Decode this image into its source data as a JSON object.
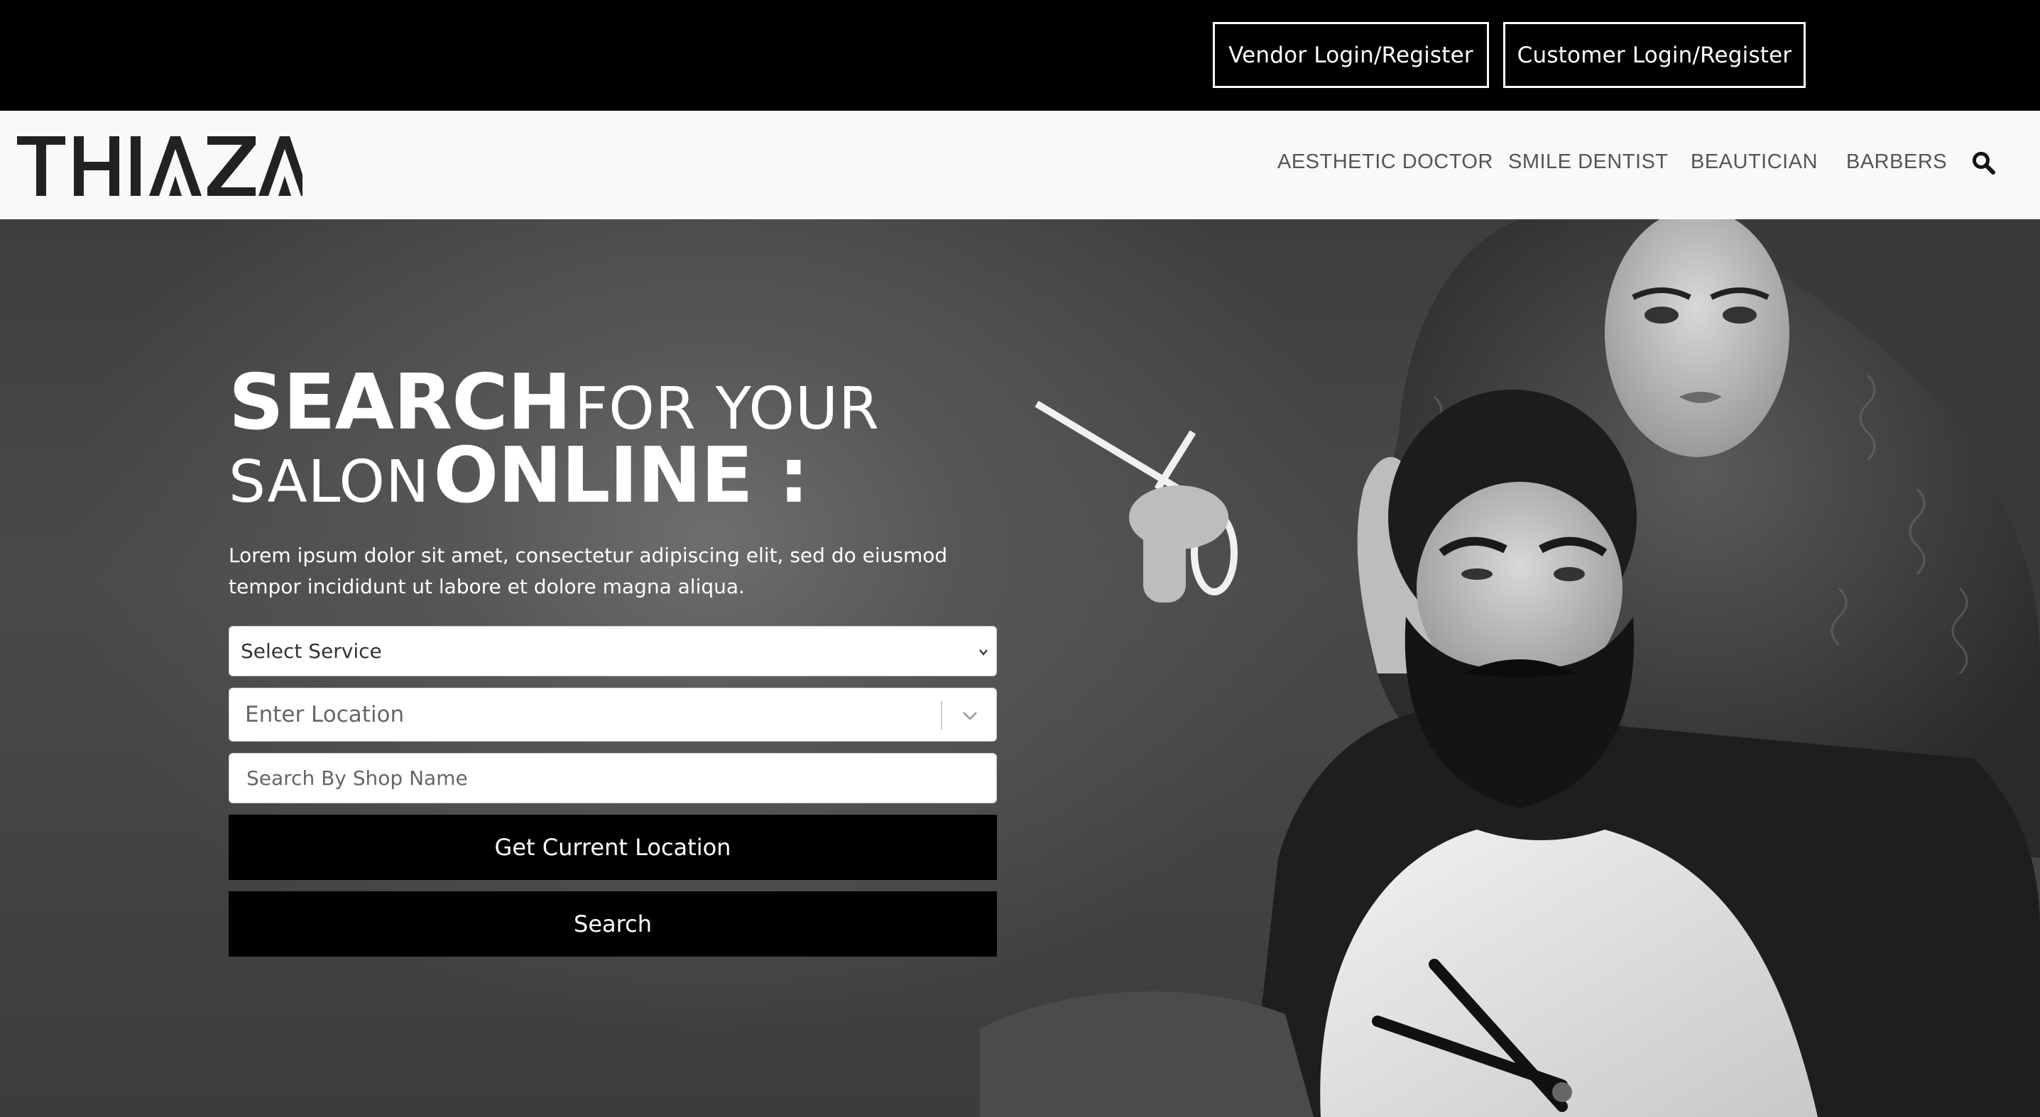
{
  "topbar": {
    "vendor_label": "Vendor Login/Register",
    "customer_label": "Customer Login/Register"
  },
  "brand": {
    "logo_text": "THIAZA"
  },
  "nav": {
    "items": [
      {
        "label": "AESTHETIC DOCTOR"
      },
      {
        "label": "SMILE DENTIST"
      },
      {
        "label": "BEAUTICIAN"
      },
      {
        "label": "BARBERS"
      }
    ],
    "search_icon": "search-icon"
  },
  "hero": {
    "headline": {
      "line1_bold": "SEARCH",
      "line1_light": "FOR YOUR",
      "line2_light": "SALON",
      "line2_bold": "ONLINE :"
    },
    "lead": "Lorem ipsum dolor sit amet, consectetur adipiscing elit, sed do eiusmod tempor incididunt ut labore et dolore magna aliqua.",
    "form": {
      "service_select_value": "Select Service",
      "location_placeholder": "Enter Location",
      "shop_name_placeholder": "Search By Shop Name",
      "current_location_label": "Get Current Location",
      "search_label": "Search"
    }
  },
  "colors": {
    "topbar_bg": "#000000",
    "navbar_bg": "#f8f9fa",
    "button_bg": "#000000",
    "nav_text": "#555555"
  }
}
